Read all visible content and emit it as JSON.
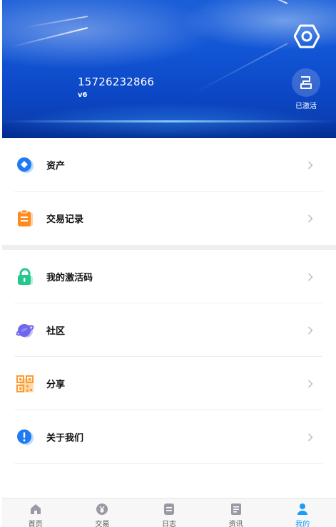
{
  "header": {
    "phone": "15726232866",
    "level": "v6",
    "activated_label": "已激活",
    "settings_icon": "settings-hexagon-icon",
    "activated_icon": "activation-icon"
  },
  "menu_group_1": [
    {
      "label": "资产",
      "icon": "asset-icon",
      "color": "#1f7cf0"
    },
    {
      "label": "交易记录",
      "icon": "clipboard-icon",
      "color": "#ff8a1f"
    }
  ],
  "menu_group_2": [
    {
      "label": "我的激活码",
      "icon": "lock-icon",
      "color": "#22c98a"
    },
    {
      "label": "社区",
      "icon": "planet-icon",
      "color": "#6f66ec"
    },
    {
      "label": "分享",
      "icon": "qr-code-icon",
      "color": "#ff9a2e"
    },
    {
      "label": "关于我们",
      "icon": "info-icon",
      "color": "#1f7cf0"
    }
  ],
  "tabbar": {
    "active_index": 4,
    "active_color": "#1a9ef5",
    "tabs": [
      {
        "label": "首页",
        "icon": "home-icon"
      },
      {
        "label": "交易",
        "icon": "yen-coin-icon"
      },
      {
        "label": "日志",
        "icon": "log-icon"
      },
      {
        "label": "资讯",
        "icon": "news-icon"
      },
      {
        "label": "我的",
        "icon": "user-icon"
      }
    ]
  }
}
